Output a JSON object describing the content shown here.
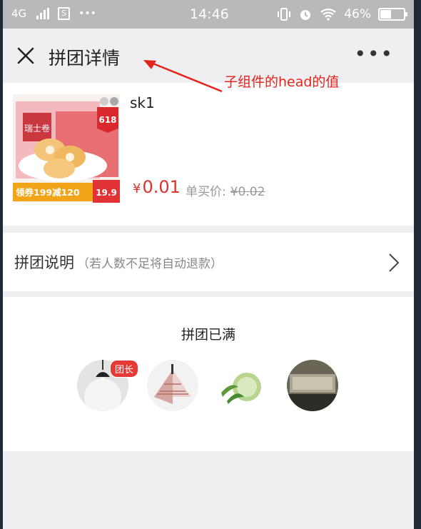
{
  "status_bar": {
    "network": "4G",
    "sim_icon": "S",
    "dots": "•••",
    "time": "14:46",
    "battery": "46%",
    "battery_level": 0.46,
    "icons": [
      "vibrate-icon",
      "alarm-icon",
      "wifi-icon"
    ]
  },
  "header": {
    "title": "拼团详情",
    "more": "•••"
  },
  "annotation": {
    "text": "子组件的head的值",
    "color": "#e5231d"
  },
  "product": {
    "name": "sk1",
    "price_symbol": "¥",
    "price": "0.01",
    "single_label": "单买价:",
    "single_price": "¥0.02",
    "image_texts": {
      "brand": "瑞士卷",
      "badge_618": "618",
      "coupon": "领券199减120",
      "price_tag": "19.9"
    }
  },
  "info": {
    "title": "拼团说明",
    "subtitle": "（若人数不足将自动退款）"
  },
  "group": {
    "status": "拼团已满",
    "leader_badge": "团长",
    "members": [
      {
        "name": "member-lamp"
      },
      {
        "name": "member-umbrella"
      },
      {
        "name": "member-aloe"
      },
      {
        "name": "member-keyboard"
      }
    ]
  },
  "colors": {
    "accent_red": "#e0322c",
    "status_bar_bg": "#b9b9bb",
    "page_bg": "#efeff1"
  }
}
